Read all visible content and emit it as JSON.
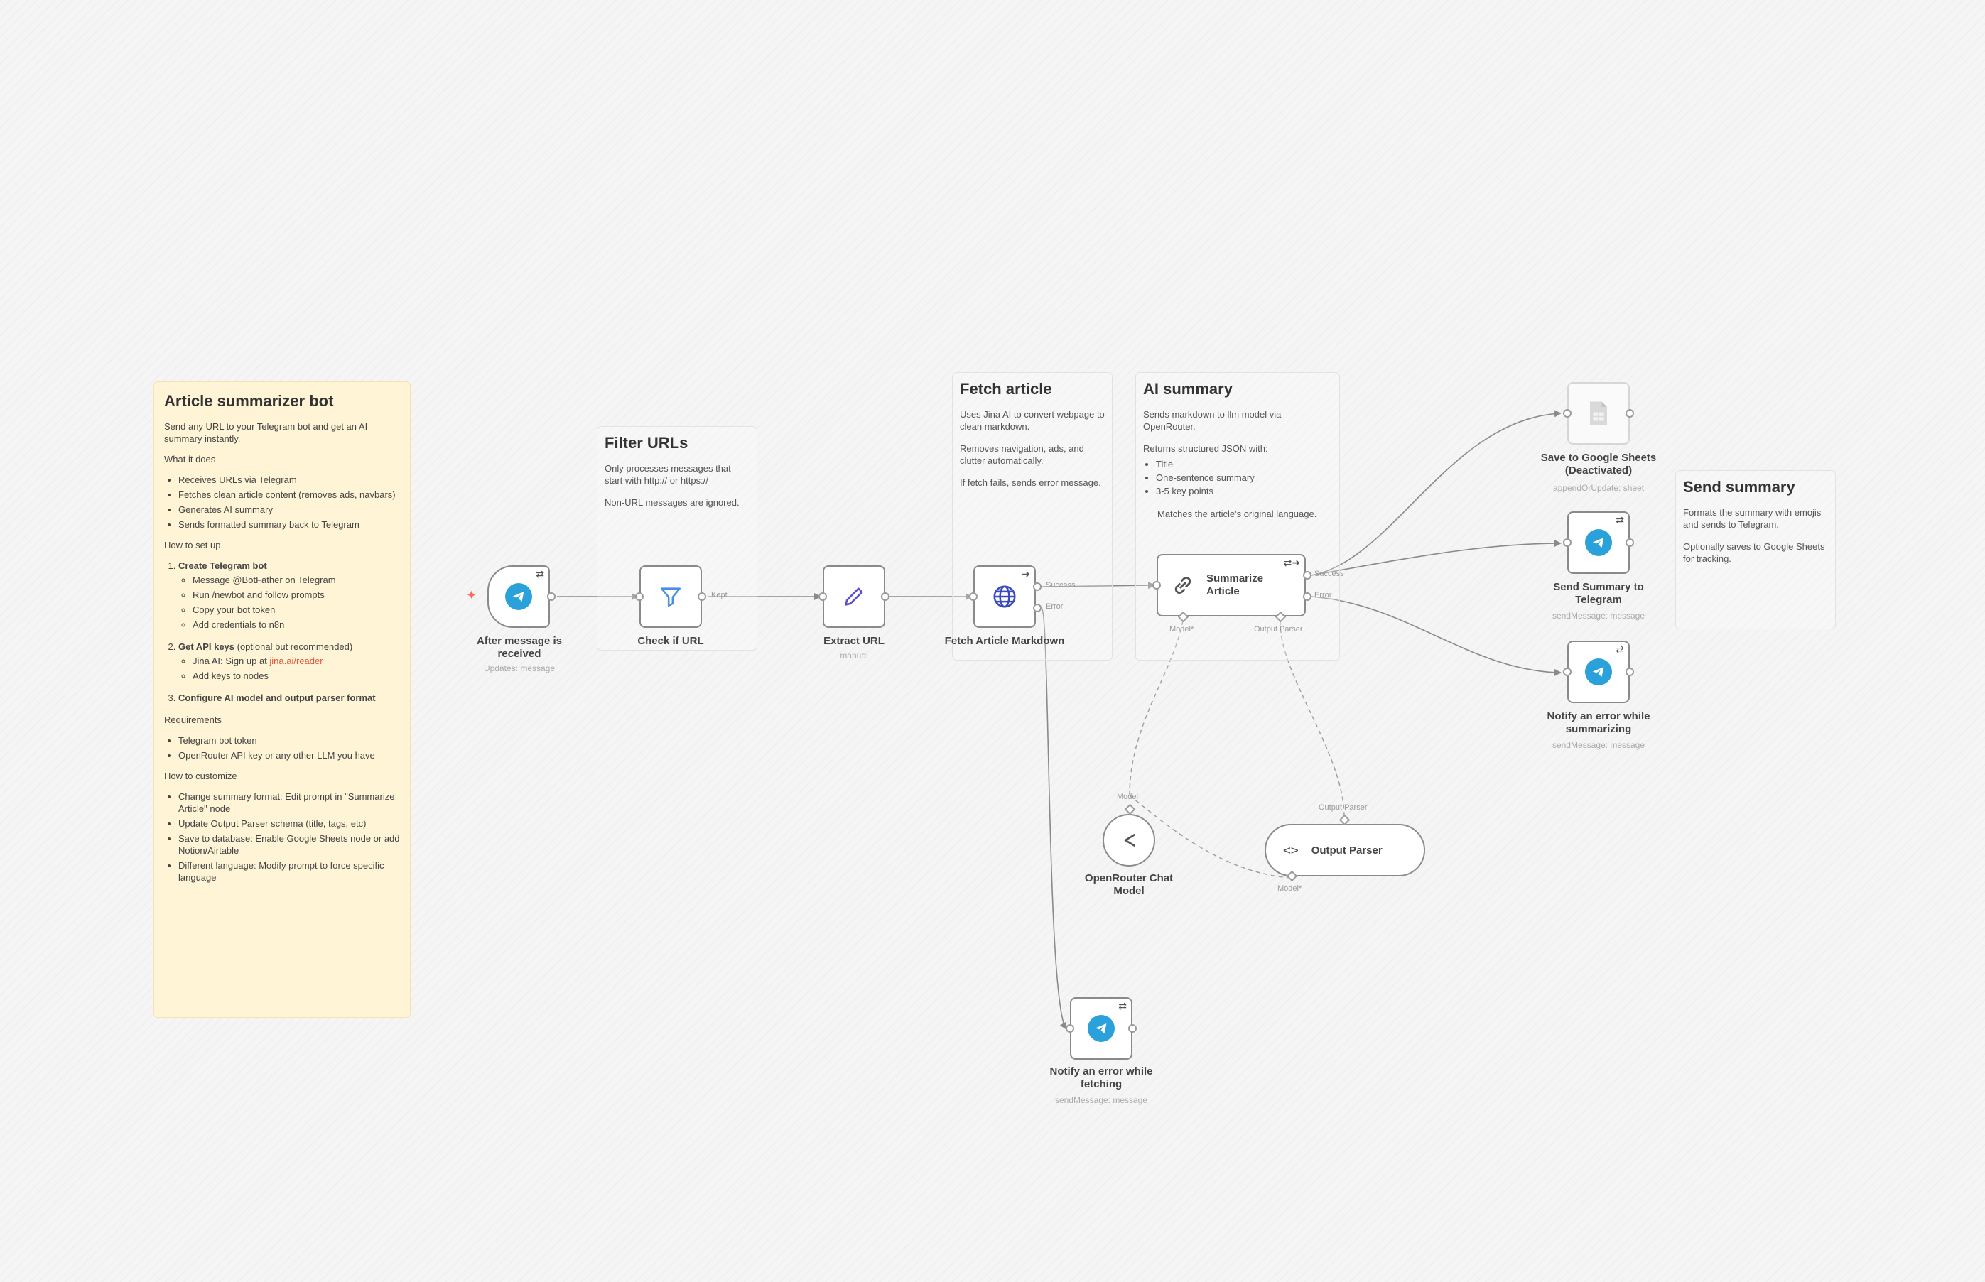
{
  "notes": {
    "main": {
      "title": "Article summarizer bot",
      "intro": "Send any URL to your Telegram bot and get an AI summary instantly.",
      "what_heading": "What it does",
      "what_items": [
        "Receives URLs via Telegram",
        "Fetches clean article content (removes ads, navbars)",
        "Generates AI summary",
        "Sends formatted summary back to Telegram"
      ],
      "setup_heading": "How to set up",
      "step1_title": "Create Telegram bot",
      "step1_items": [
        "Message @BotFather on Telegram",
        "Run /newbot and follow prompts",
        "Copy your bot token",
        "Add credentials to n8n"
      ],
      "step2_title": "Get API keys",
      "step2_suffix": " (optional but recommended)",
      "step2_item1_prefix": "Jina AI: Sign up at ",
      "step2_item1_link": "jina.ai/reader",
      "step2_item2": "Add keys to nodes",
      "step3_title": "Configure AI model and output parser format",
      "req_heading": "Requirements",
      "req_items": [
        "Telegram bot token",
        "OpenRouter API key or any other LLM you have"
      ],
      "custom_heading": "How to customize",
      "custom_items": [
        "Change summary format: Edit prompt in \"Summarize Article\" node",
        "Update Output Parser schema (title, tags, etc)",
        "Save to database: Enable Google Sheets node or add Notion/Airtable",
        "Different language: Modify prompt to force specific language"
      ]
    },
    "filter": {
      "title": "Filter URLs",
      "p1": "Only processes messages that start with http:// or https://",
      "p2": "Non-URL messages are ignored."
    },
    "fetch": {
      "title": "Fetch article",
      "p1": "Uses Jina AI to convert webpage to clean markdown.",
      "p2": "Removes navigation, ads, and clutter automatically.",
      "p3": "If fetch fails, sends error message."
    },
    "ai": {
      "title": "AI summary",
      "p1": "Sends markdown to llm model via OpenRouter.",
      "p2": "Returns structured JSON with:",
      "items": [
        "Title",
        "One-sentence summary",
        "3-5 key points"
      ],
      "p3": "Matches the article's original language."
    },
    "send": {
      "title": "Send summary",
      "p1": "Formats the summary with emojis and sends to Telegram.",
      "p2": "Optionally saves to Google Sheets for tracking."
    }
  },
  "nodes": {
    "trigger": {
      "label": "After message is received",
      "sub": "Updates: message"
    },
    "check_url": {
      "label": "Check if URL",
      "port_keep": "Kept"
    },
    "extract_url": {
      "label": "Extract URL",
      "sub": "manual"
    },
    "fetch": {
      "label": "Fetch Article Markdown",
      "port_success": "Success",
      "port_error": "Error"
    },
    "summarize": {
      "label": "Summarize Article",
      "port_success": "Success",
      "port_error": "Error",
      "port_model": "Model*",
      "port_parser": "Output Parser"
    },
    "openrouter": {
      "label": "OpenRouter Chat Model",
      "port_model": "Model"
    },
    "output_parser": {
      "label": "Output Parser",
      "port_parser": "Output Parser",
      "port_model": "Model*"
    },
    "sheets": {
      "label": "Save to Google Sheets (Deactivated)",
      "sub": "appendOrUpdate: sheet"
    },
    "send_summary": {
      "label": "Send Summary to Telegram",
      "sub": "sendMessage: message"
    },
    "notify_summarizing": {
      "label": "Notify an error while summarizing",
      "sub": "sendMessage: message"
    },
    "notify_fetching": {
      "label": "Notify an error while fetching",
      "sub": "sendMessage: message"
    }
  },
  "colors": {
    "canvas": "#f5f5f5",
    "sticky_yellow": "#fff5d6",
    "telegram": "#2aa1da",
    "trigger_bolt": "#ff6d5a",
    "filter_icon": "#4a90e2",
    "edit_icon": "#5a4fcf",
    "globe_icon": "#3b49c0",
    "link": "#e0583f"
  },
  "icons": {
    "trigger": "telegram-icon",
    "check_url": "filter-icon",
    "extract_url": "pencil-icon",
    "fetch": "globe-icon",
    "summarize": "chain-link-icon",
    "openrouter": "openrouter-icon",
    "output_parser": "code-brackets-icon",
    "sheets": "google-sheets-icon"
  }
}
